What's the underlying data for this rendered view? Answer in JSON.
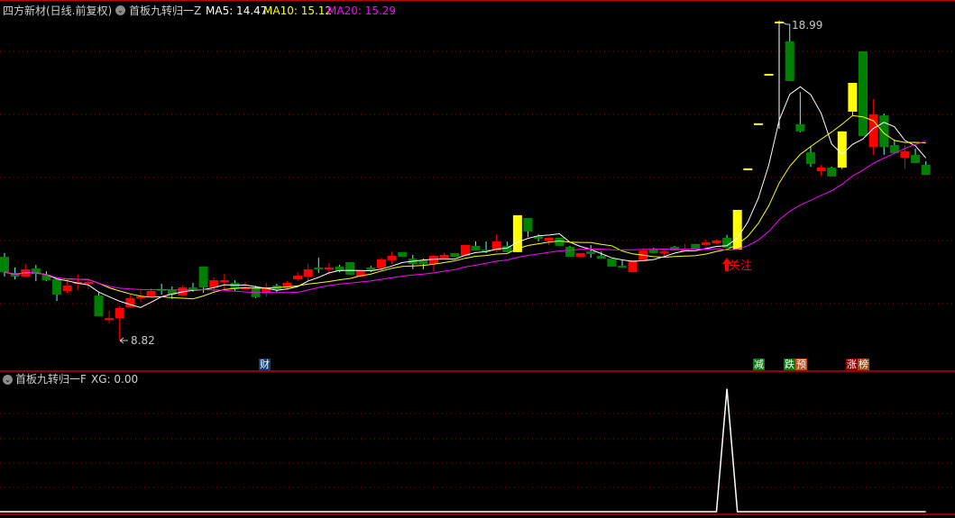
{
  "header": {
    "stock_title": "四方新材(日线.前复权)",
    "indicator_name": "首板九转归一Z",
    "ma5_label": "MA5: 14.47",
    "ma10_label": "MA10: 15.12",
    "ma20_label": "MA20: 15.29"
  },
  "sub_header": {
    "indicator_name": "首板九转归一F",
    "xg_label": "XG: 0.00"
  },
  "annotations": {
    "high_label": "18.99",
    "low_label": "8.82",
    "watch_label": "关注"
  },
  "event_tags": [
    {
      "text": "财",
      "color": "#0a3f7a"
    },
    {
      "text": "减",
      "color": "#0a7a10"
    },
    {
      "text": "跌",
      "color": "#0a7a10"
    },
    {
      "text": "预",
      "color": "#c0501a"
    },
    {
      "text": "涨",
      "color": "#8a0000"
    },
    {
      "text": "榜",
      "color": "#9a4a10"
    }
  ],
  "colors": {
    "up": "#ff0000",
    "down": "#008000",
    "down_wick": "#54ffff",
    "limit": "#ffff00",
    "ma5": "#ffffff",
    "ma10": "#ffff00",
    "ma20": "#ff00ff",
    "grid": "#a00000"
  },
  "chart_data": {
    "type": "candlestick",
    "title": "四方新材 日线 前复权",
    "ylim": [
      8.5,
      19.2
    ],
    "ma_periods": [
      5,
      10,
      20
    ],
    "candles_ohlc": [
      [
        11.5,
        11.62,
        10.87,
        11.01
      ],
      [
        10.98,
        11.16,
        10.78,
        10.87
      ],
      [
        10.87,
        11.27,
        10.87,
        11.1
      ],
      [
        11.13,
        11.24,
        10.72,
        10.95
      ],
      [
        10.93,
        11.04,
        10.72,
        10.75
      ],
      [
        10.78,
        10.78,
        10.09,
        10.29
      ],
      [
        10.41,
        10.78,
        10.35,
        10.58
      ],
      [
        10.64,
        10.93,
        10.44,
        10.7
      ],
      [
        10.64,
        10.78,
        10.47,
        10.7
      ],
      [
        10.26,
        10.35,
        9.6,
        9.6
      ],
      [
        9.49,
        9.77,
        9.37,
        9.54
      ],
      [
        9.54,
        9.92,
        8.82,
        9.86
      ],
      [
        9.89,
        10.29,
        9.89,
        10.18
      ],
      [
        10.18,
        10.47,
        10.06,
        10.23
      ],
      [
        10.23,
        10.49,
        10.21,
        10.41
      ],
      [
        10.47,
        10.64,
        10.29,
        10.44
      ],
      [
        10.44,
        10.55,
        10.15,
        10.29
      ],
      [
        10.26,
        10.58,
        10.23,
        10.52
      ],
      [
        10.52,
        10.67,
        10.38,
        10.49
      ],
      [
        11.19,
        11.19,
        10.35,
        10.52
      ],
      [
        10.52,
        10.84,
        10.35,
        10.75
      ],
      [
        10.69,
        10.95,
        10.44,
        10.75
      ],
      [
        10.67,
        10.75,
        10.41,
        10.47
      ],
      [
        10.47,
        10.7,
        10.44,
        10.52
      ],
      [
        10.52,
        10.58,
        10.18,
        10.21
      ],
      [
        10.35,
        10.67,
        10.23,
        10.52
      ],
      [
        10.58,
        10.64,
        10.38,
        10.44
      ],
      [
        10.52,
        10.72,
        10.44,
        10.67
      ],
      [
        10.78,
        11.01,
        10.72,
        10.9
      ],
      [
        10.87,
        11.27,
        10.72,
        11.1
      ],
      [
        11.16,
        11.47,
        10.98,
        11.1
      ],
      [
        11.1,
        11.3,
        10.93,
        11.16
      ],
      [
        11.19,
        11.24,
        11.01,
        11.04
      ],
      [
        11.33,
        11.33,
        10.93,
        10.93
      ],
      [
        10.87,
        11.04,
        10.84,
        11.07
      ],
      [
        11.16,
        11.21,
        11.01,
        11.07
      ],
      [
        11.13,
        11.47,
        11.07,
        11.42
      ],
      [
        11.39,
        11.67,
        11.27,
        11.53
      ],
      [
        11.65,
        11.65,
        11.5,
        11.5
      ],
      [
        11.44,
        11.56,
        11.1,
        11.27
      ],
      [
        11.39,
        11.44,
        11.1,
        11.27
      ],
      [
        11.27,
        11.56,
        11.04,
        11.53
      ],
      [
        11.44,
        11.62,
        11.42,
        11.56
      ],
      [
        11.62,
        11.62,
        11.5,
        11.5
      ],
      [
        11.53,
        11.88,
        11.5,
        11.88
      ],
      [
        11.85,
        12.0,
        11.7,
        11.7
      ],
      [
        11.73,
        11.99,
        11.62,
        11.67
      ],
      [
        11.7,
        12.22,
        11.65,
        11.99
      ],
      [
        11.85,
        11.99,
        11.65,
        11.65
      ],
      [
        11.65,
        12.83,
        11.65,
        12.83
      ],
      [
        12.74,
        12.74,
        12.13,
        12.31
      ],
      [
        12.16,
        12.22,
        11.99,
        12.08
      ],
      [
        12.02,
        12.11,
        11.88,
        12.11
      ],
      [
        12.11,
        12.11,
        11.85,
        11.85
      ],
      [
        11.82,
        11.85,
        11.5,
        11.5
      ],
      [
        11.5,
        11.62,
        11.5,
        11.62
      ],
      [
        11.67,
        11.88,
        11.47,
        11.59
      ],
      [
        11.53,
        11.67,
        11.44,
        11.44
      ],
      [
        11.44,
        11.44,
        11.19,
        11.19
      ],
      [
        11.21,
        11.39,
        11.16,
        11.16
      ],
      [
        11.01,
        11.39,
        11.01,
        11.39
      ],
      [
        11.36,
        11.76,
        11.36,
        11.7
      ],
      [
        11.73,
        11.79,
        11.62,
        11.62
      ],
      [
        11.62,
        11.7,
        11.53,
        11.67
      ],
      [
        11.82,
        11.85,
        11.7,
        11.7
      ],
      [
        11.67,
        11.91,
        11.67,
        11.76
      ],
      [
        11.91,
        11.91,
        11.73,
        11.73
      ],
      [
        11.88,
        12.05,
        11.82,
        11.96
      ],
      [
        11.93,
        12.05,
        11.9,
        12.02
      ],
      [
        12.11,
        12.2,
        11.79,
        11.79
      ],
      [
        11.73,
        13.0,
        11.73,
        13.0
      ],
      [
        14.3,
        14.3,
        14.3,
        14.3
      ],
      [
        15.74,
        15.74,
        15.74,
        15.74
      ],
      [
        17.32,
        17.32,
        17.32,
        17.32
      ],
      [
        18.99,
        18.99,
        18.99,
        18.99
      ],
      [
        18.39,
        18.93,
        17.12,
        17.12
      ],
      [
        15.74,
        16.77,
        15.48,
        15.51
      ],
      [
        14.84,
        15.04,
        14.38,
        14.47
      ],
      [
        14.24,
        14.44,
        14.1,
        14.35
      ],
      [
        14.35,
        14.38,
        14.07,
        14.07
      ],
      [
        14.35,
        15.51,
        14.3,
        15.51
      ],
      [
        16.14,
        17.06,
        16.02,
        17.06
      ],
      [
        18.07,
        18.07,
        15.36,
        15.36
      ],
      [
        15.01,
        16.54,
        14.76,
        16.05
      ],
      [
        16.02,
        16.08,
        14.76,
        15.01
      ],
      [
        15.07,
        15.25,
        14.81,
        14.81
      ],
      [
        14.67,
        15.07,
        14.32,
        14.87
      ],
      [
        14.76,
        14.96,
        14.5,
        14.5
      ],
      [
        14.44,
        14.55,
        14.12,
        14.12
      ]
    ],
    "limit_up_indices": [
      49,
      70,
      71,
      72,
      73,
      74,
      80,
      81
    ],
    "xg": {
      "name": "XG",
      "ylim": [
        0,
        1.1
      ],
      "nonzero": {
        "index": 69,
        "value": 1
      }
    }
  }
}
